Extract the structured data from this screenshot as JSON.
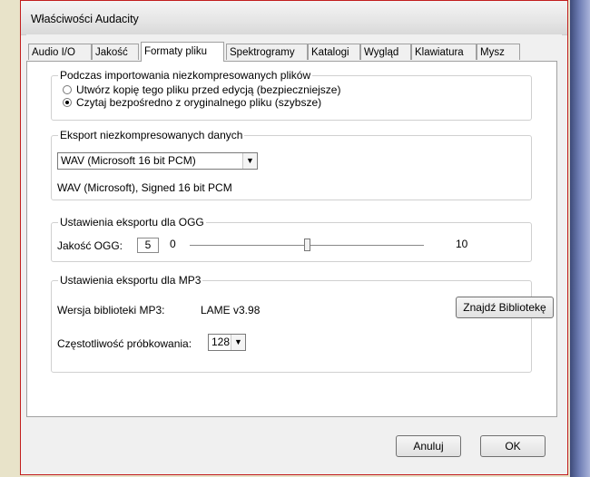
{
  "window": {
    "title": "Właściwości Audacity"
  },
  "tabs": [
    {
      "label": "Audio I/O"
    },
    {
      "label": "Jakość"
    },
    {
      "label": "Formaty pliku"
    },
    {
      "label": "Spektrogramy"
    },
    {
      "label": "Katalogi"
    },
    {
      "label": "Wygląd"
    },
    {
      "label": "Klawiatura"
    },
    {
      "label": "Mysz"
    }
  ],
  "import_group": {
    "legend": "Podczas importowania niezkompresowanych plików",
    "options": [
      {
        "label": "Utwórz kopię tego pliku przed edycją (bezpieczniejsze)",
        "checked": false
      },
      {
        "label": "Czytaj bezpośredno z oryginalnego pliku (szybsze)",
        "checked": true
      }
    ]
  },
  "export_group": {
    "legend": "Eksport niezkompresowanych danych",
    "format_selected": "WAV (Microsoft 16 bit PCM)",
    "description": "WAV (Microsoft), Signed 16 bit PCM"
  },
  "ogg_group": {
    "legend": "Ustawienia eksportu dla OGG",
    "quality_label": "Jakość OGG:",
    "quality_value": "5",
    "slider_min": "0",
    "slider_max": "10"
  },
  "mp3_group": {
    "legend": "Ustawienia eksportu dla MP3",
    "library_label": "Wersja biblioteki MP3:",
    "library_version": "LAME v3.98",
    "find_library_button": "Znajdź Bibliotekę",
    "sample_rate_label": "Częstotliwość próbkowania:",
    "sample_rate_value": "128"
  },
  "footer": {
    "cancel_button": "Anuluj",
    "ok_button": "OK"
  }
}
